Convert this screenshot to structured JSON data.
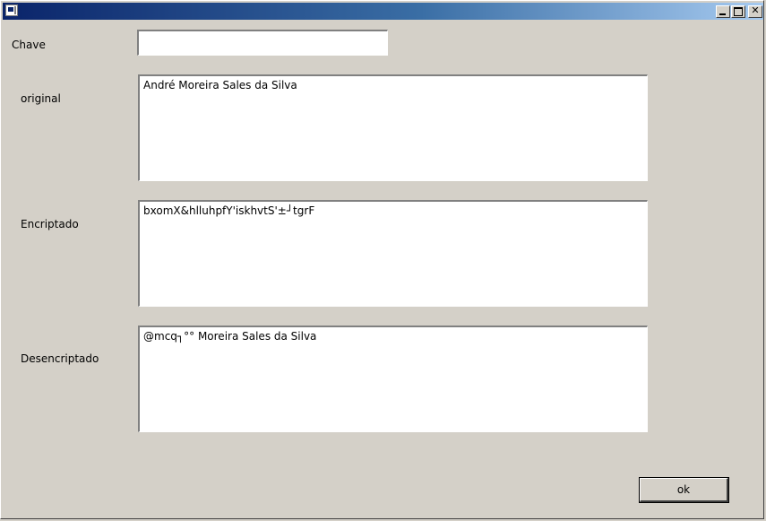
{
  "window": {
    "title": ""
  },
  "form": {
    "chave": {
      "label": "Chave",
      "value": ""
    },
    "original": {
      "label": "original",
      "value": "André Moreira Sales da Silva"
    },
    "encriptado": {
      "label": "Encriptado",
      "value": "bxomX&hlluhpfY'iskhvtS'±┘tgrF"
    },
    "desencriptado": {
      "label": "Desencriptado",
      "value": "@mcq┐°° Moreira Sales da Silva"
    }
  },
  "ok_button": {
    "label": "ok"
  }
}
